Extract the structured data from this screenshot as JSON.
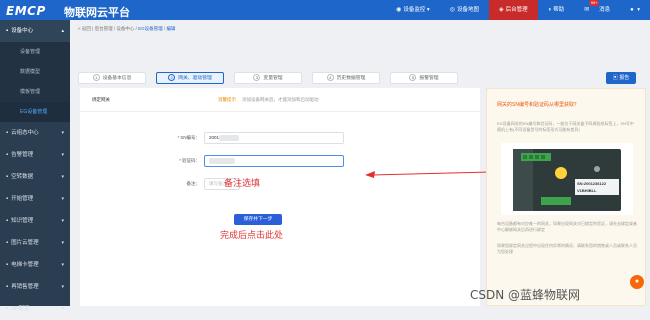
{
  "header": {
    "logo": "EMCP",
    "brand": "物联网云平台",
    "nav": [
      {
        "icon": "monitor-icon",
        "label": "设备监控",
        "active": false,
        "chev": true
      },
      {
        "icon": "map-icon",
        "label": "设备地图",
        "active": false
      },
      {
        "icon": "admin-icon",
        "label": "后台管理",
        "active": true
      },
      {
        "icon": "help-icon",
        "label": "帮助",
        "active": false
      },
      {
        "icon": "bell-icon",
        "label": "消息",
        "badge": "99+",
        "active": false
      },
      {
        "icon": "user-icon",
        "label": "",
        "active": false,
        "chev": true
      }
    ]
  },
  "sidebar": {
    "groups": [
      {
        "label": "设备中心",
        "open": true,
        "subs": [
          {
            "label": "设备管理",
            "active": false
          },
          {
            "label": "数据模型",
            "active": false
          },
          {
            "label": "模板管理",
            "active": false
          },
          {
            "label": "EG设备管理",
            "active": true
          }
        ]
      },
      {
        "label": "云组态中心",
        "open": false
      },
      {
        "label": "告警管理",
        "open": false
      },
      {
        "label": "空转数据",
        "open": false
      },
      {
        "label": "开始管理",
        "open": false
      },
      {
        "label": "知识管理",
        "open": false
      },
      {
        "label": "图片云管理",
        "open": false
      },
      {
        "label": "电梯卡管理",
        "open": false
      },
      {
        "label": "再销售管理",
        "open": false
      },
      {
        "label": "AP配置",
        "open": false
      }
    ]
  },
  "breadcrumb": {
    "back": "< 返回",
    "items": [
      "后台管理",
      "设备中心",
      "EG设备管理"
    ],
    "current": "编辑"
  },
  "tabs": [
    {
      "num": "1",
      "label": "设备基本信息",
      "active": false
    },
    {
      "num": "2",
      "label": "网关、驱动管理",
      "active": true
    },
    {
      "num": "3",
      "label": "变量管理",
      "active": false
    },
    {
      "num": "4",
      "label": "历史数据管理",
      "active": false
    },
    {
      "num": "5",
      "label": "报警管理",
      "active": false
    }
  ],
  "report_button": "报告",
  "form": {
    "section_title": "绑定网关",
    "note_key": "温馨提示",
    "note_value": "添加设备网关后，才能添加和启动驱动",
    "sn_label": "SN编号：",
    "sn_value": "2001D",
    "code_label": "验证码：",
    "remark_label": "备注：",
    "remark_placeholder": "填写备注",
    "save_label": "保存并下一步"
  },
  "annotations": {
    "remark": "备注选填",
    "save": "完成后点击此处"
  },
  "help": {
    "title": "网关的SN编号和验证码从哪里获取？",
    "p1": "EG设备网关的SN编号和验证码，一般位于网关盒子四周贴纸标签上，SN号中随机上有(不同设备型号的标签形式可能有差异)",
    "device_sn": "SN:2001236122",
    "device_code": "V1BHIBLL",
    "device_top": "DC24V RS485",
    "p2": "每台设备都有对应唯一的网关，如果出现网关对已绑定的验证，请先去绑定或者中心解绑网关后再进行绑定",
    "p3": "如果您绑定网关过程中出现任何异常的情况，请联系您的销售或人员或联系人员为您处理"
  },
  "watermark": "CSDN @蓝蜂物联网"
}
